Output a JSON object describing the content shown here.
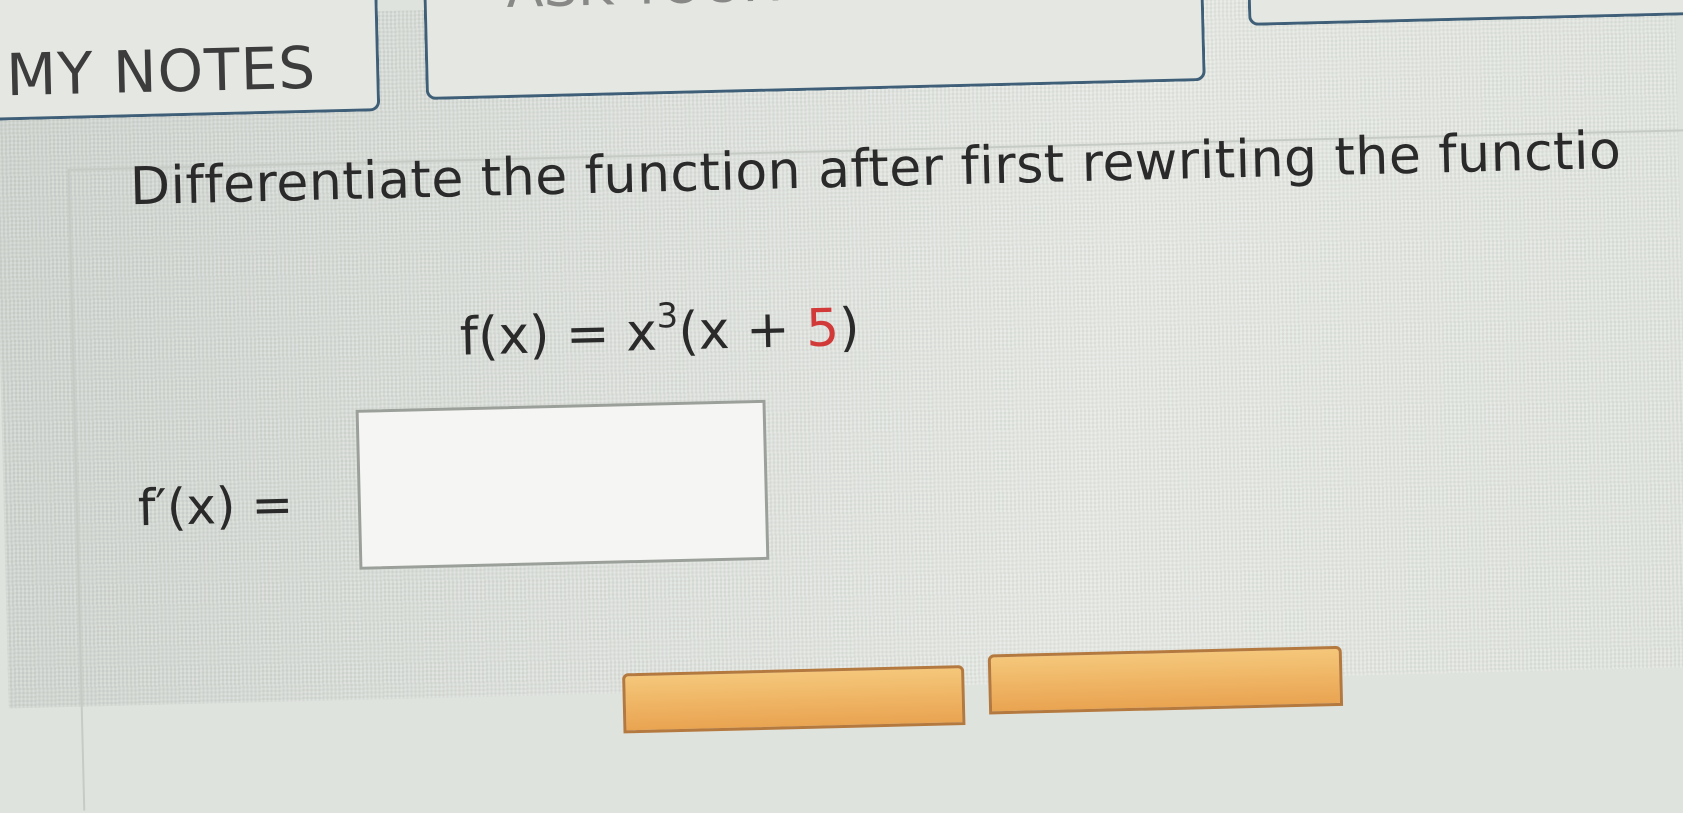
{
  "toolbar": {
    "my_notes_label": "MY NOTES",
    "ask_label": "ASK YOUR TEACHER"
  },
  "question": {
    "prompt": "Differentiate the function after first rewriting the functio",
    "equation": {
      "lhs": "f(x) = x",
      "exponent": "3",
      "open": "(x + ",
      "constant": "5",
      "close": ")"
    },
    "derivative_label": "f′(x) =",
    "answer_value": ""
  },
  "colors": {
    "button_border": "#3f5f78",
    "highlight_number": "#d23a3a",
    "action_button": "#e9a451"
  }
}
